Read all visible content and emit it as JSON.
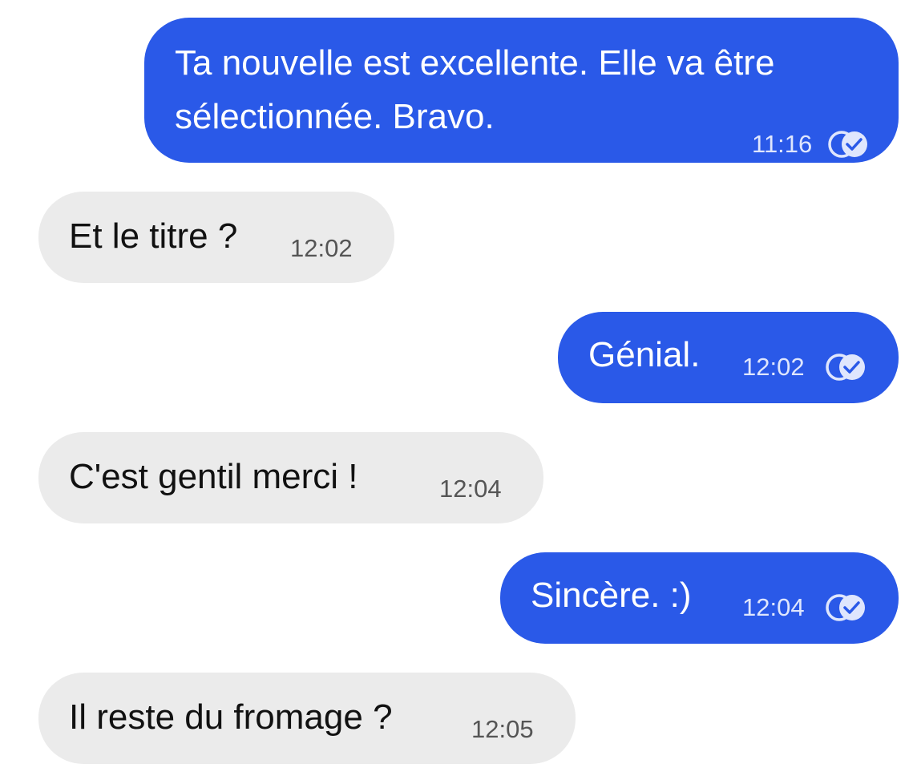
{
  "messages": [
    {
      "direction": "outgoing",
      "text": "Ta nouvelle est excellente. Elle va être\nsélectionnée. Bravo.",
      "time": "11:16",
      "status": "read-receipt-icon"
    },
    {
      "direction": "incoming",
      "text": "Et le titre ?",
      "time": "12:02"
    },
    {
      "direction": "outgoing",
      "text": "Génial.",
      "time": "12:02",
      "status": "read-receipt-icon"
    },
    {
      "direction": "incoming",
      "text": "C'est gentil merci !",
      "time": "12:04"
    },
    {
      "direction": "outgoing",
      "text": "Sincère. :)",
      "time": "12:04",
      "status": "read-receipt-icon"
    },
    {
      "direction": "incoming",
      "text": "Il reste du fromage ?",
      "time": "12:05"
    }
  ],
  "colors": {
    "outgoing_bubble": "#2a59e8",
    "incoming_bubble": "#ebebeb",
    "outgoing_text": "#ffffff",
    "incoming_text": "#111111"
  }
}
